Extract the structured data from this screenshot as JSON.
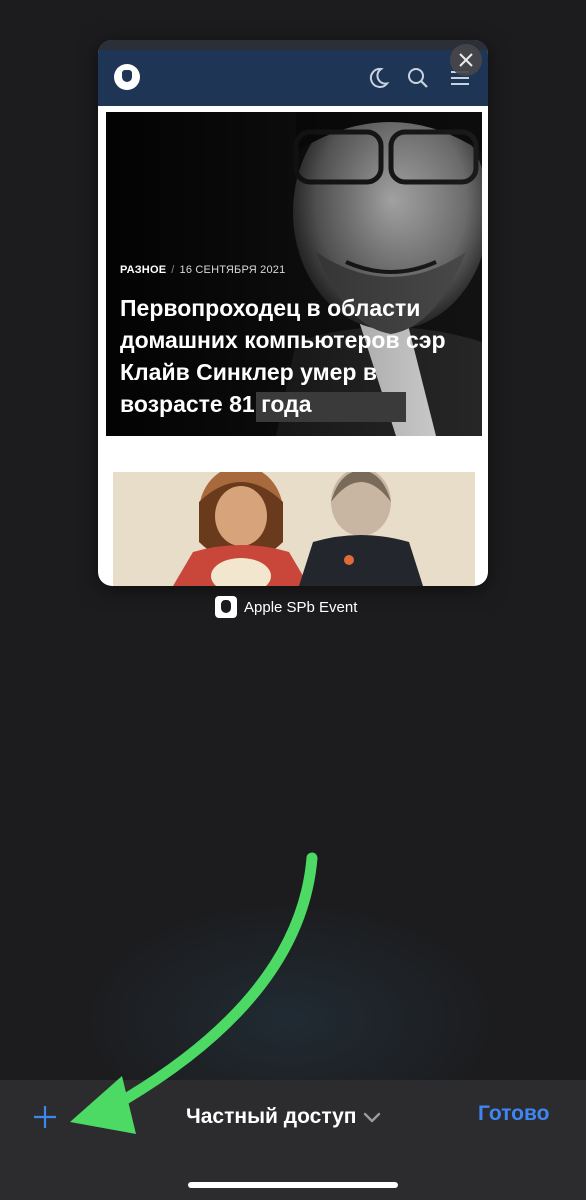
{
  "tab": {
    "article": {
      "category": "РАЗНОЕ",
      "separator": "/",
      "date": "16 СЕНТЯБРЯ 2021",
      "title": "Первопроходец в области домашних компьютеров сэр Клайв Синклер умер в возрасте 81 года"
    },
    "site_name": "Apple SPb Event",
    "header_icons": [
      "moon-icon",
      "search-icon",
      "menu-icon"
    ]
  },
  "toolbar": {
    "mode_label": "Частный доступ",
    "done_label": "Готово"
  },
  "colors": {
    "accent": "#3f86f5",
    "annotation_arrow": "#4cd964",
    "site_header": "#1f3556"
  }
}
